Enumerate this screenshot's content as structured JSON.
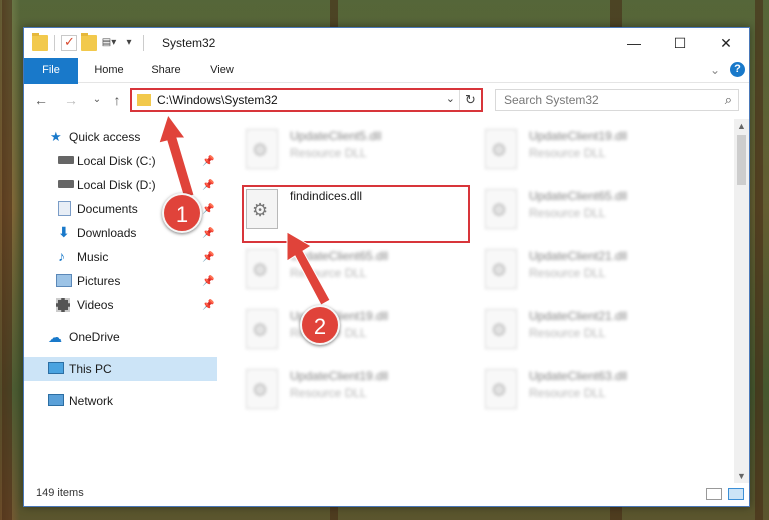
{
  "window": {
    "title": "System32",
    "minimize": "—",
    "maximize": "☐",
    "close": "✕"
  },
  "ribbon": {
    "tabs": [
      "File",
      "Home",
      "Share",
      "View"
    ],
    "expand": "⌄",
    "help": "?"
  },
  "navigation": {
    "back": "←",
    "forward": "→",
    "recent": "⌄",
    "up": "↑",
    "address": "C:\\Windows\\System32",
    "address_dropdown": "⌄",
    "refresh": "↻",
    "search_placeholder": "Search System32",
    "search_icon": "⌕"
  },
  "sidebar": {
    "items": [
      {
        "label": "Quick access",
        "icon": "star-icon",
        "pinned": false
      },
      {
        "label": "Local Disk (C:)",
        "icon": "drive-icon",
        "pinned": true
      },
      {
        "label": "Local Disk (D:)",
        "icon": "drive-icon",
        "pinned": true
      },
      {
        "label": "Documents",
        "icon": "documents-icon",
        "pinned": true
      },
      {
        "label": "Downloads",
        "icon": "download-icon",
        "pinned": true
      },
      {
        "label": "Music",
        "icon": "music-icon",
        "pinned": true
      },
      {
        "label": "Pictures",
        "icon": "pictures-icon",
        "pinned": true
      },
      {
        "label": "Videos",
        "icon": "videos-icon",
        "pinned": true
      },
      {
        "label": "OneDrive",
        "icon": "cloud-icon",
        "pinned": false
      },
      {
        "label": "This PC",
        "icon": "computer-icon",
        "pinned": false,
        "selected": true
      },
      {
        "label": "Network",
        "icon": "network-icon",
        "pinned": false
      }
    ],
    "pin_glyph": "📌"
  },
  "files": [
    {
      "name": "UpdateClient5.dll",
      "type": "Resource DLL",
      "blurred": true
    },
    {
      "name": "UpdateClient19.dll",
      "type": "Resource DLL",
      "blurred": true
    },
    {
      "name": "findindices.dll",
      "type": "",
      "blurred": false,
      "highlighted": true
    },
    {
      "name": "UpdateClient65.dll",
      "type": "Resource DLL",
      "blurred": true
    },
    {
      "name": "UpdateClient65.dll",
      "type": "Resource DLL",
      "blurred": true
    },
    {
      "name": "UpdateClient21.dll",
      "type": "Resource DLL",
      "blurred": true
    },
    {
      "name": "UpdateClient19.dll",
      "type": "Resource DLL",
      "blurred": true
    },
    {
      "name": "UpdateClient21.dll",
      "type": "Resource DLL",
      "blurred": true
    },
    {
      "name": "UpdateClient19.dll",
      "type": "Resource DLL",
      "blurred": true
    },
    {
      "name": "UpdateClient63.dll",
      "type": "Resource DLL",
      "blurred": true
    }
  ],
  "status": {
    "item_count": "149 items"
  },
  "annotations": {
    "step1": "1",
    "step2": "2",
    "color": "#e0433a"
  },
  "colors": {
    "accent": "#1979ca",
    "highlight_border": "#d8353a",
    "selection": "#cce4f7"
  }
}
